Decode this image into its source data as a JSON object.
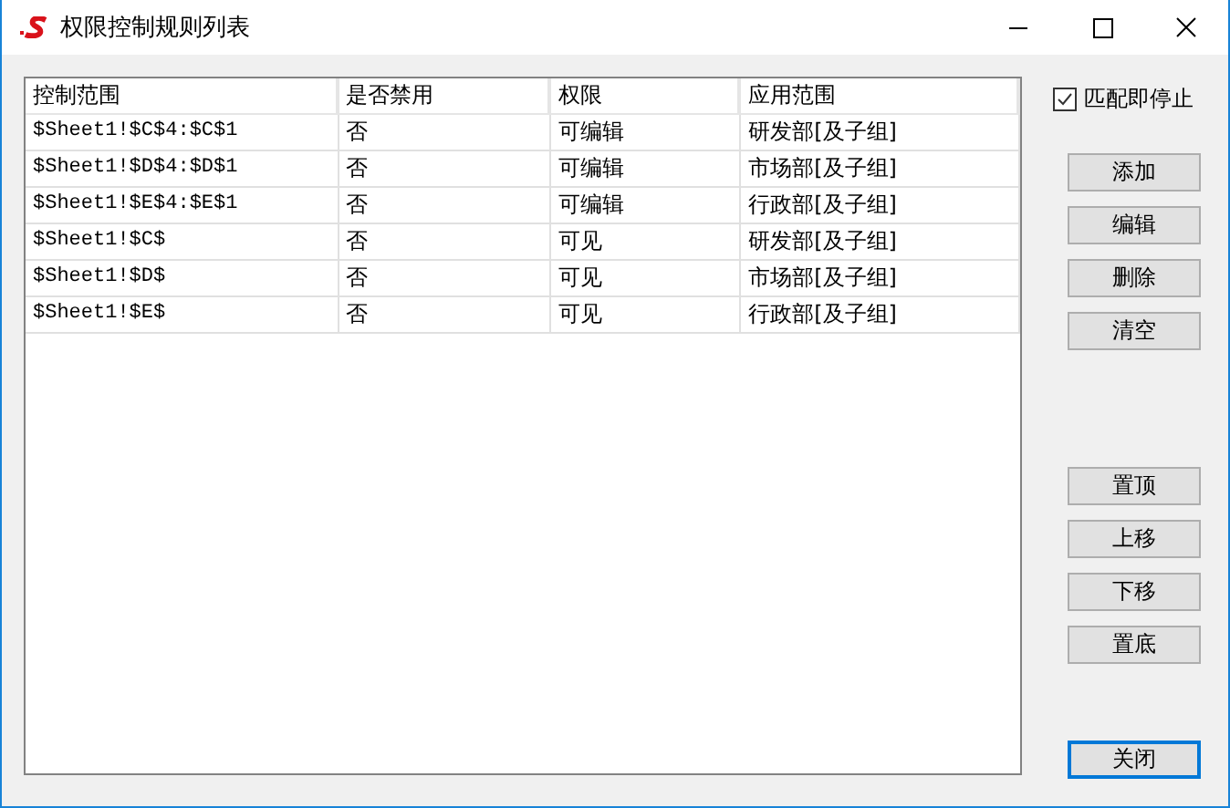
{
  "window": {
    "title": "权限控制规则列表"
  },
  "table": {
    "columns": [
      "控制范围",
      "是否禁用",
      "权限",
      "应用范围"
    ],
    "rows": [
      [
        "$Sheet1!$C$4:$C$1",
        "否",
        "可编辑",
        "研发部[及子组]"
      ],
      [
        "$Sheet1!$D$4:$D$1",
        "否",
        "可编辑",
        "市场部[及子组]"
      ],
      [
        "$Sheet1!$E$4:$E$1",
        "否",
        "可编辑",
        "行政部[及子组]"
      ],
      [
        "$Sheet1!$C$",
        "否",
        "可见",
        "研发部[及子组]"
      ],
      [
        "$Sheet1!$D$",
        "否",
        "可见",
        "市场部[及子组]"
      ],
      [
        "$Sheet1!$E$",
        "否",
        "可见",
        "行政部[及子组]"
      ]
    ]
  },
  "match_stop": {
    "label": "匹配即停止",
    "checked": true
  },
  "edit_buttons": [
    "添加",
    "编辑",
    "删除",
    "清空"
  ],
  "order_buttons": [
    "置顶",
    "上移",
    "下移",
    "置底"
  ],
  "close_button": {
    "label": "关闭",
    "focused": true
  }
}
